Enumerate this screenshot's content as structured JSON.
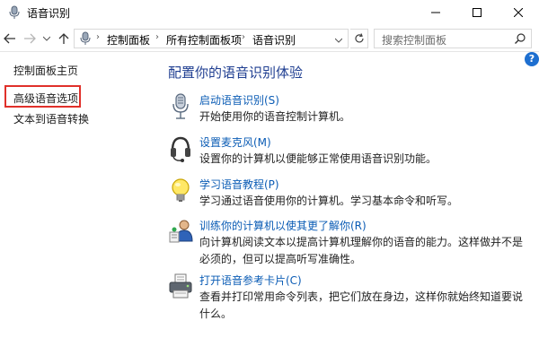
{
  "window": {
    "title": "语音识别"
  },
  "address_bar": {
    "breadcrumbs": [
      "控制面板",
      "所有控制面板项",
      "语音识别"
    ]
  },
  "search": {
    "placeholder": "搜索控制面板"
  },
  "help": {
    "label": "?"
  },
  "sidebar": {
    "items": [
      {
        "label": "控制面板主页"
      },
      {
        "label": "高级语音选项"
      },
      {
        "label": "文本到语音转换"
      }
    ]
  },
  "main": {
    "title": "配置你的语音识别体验",
    "tasks": [
      {
        "icon": "microphone-icon",
        "link": "启动语音识别(S)",
        "description": "开始使用你的语音控制计算机。"
      },
      {
        "icon": "headset-icon",
        "link": "设置麦克风(M)",
        "description": "设置你的计算机以便能够正常使用语音识别功能。"
      },
      {
        "icon": "lightbulb-icon",
        "link": "学习语音教程(P)",
        "description": "学习通过语音使用你的计算机。学习基本命令和听写。"
      },
      {
        "icon": "user-training-icon",
        "link": "训练你的计算机以使其更了解你(R)",
        "description": "向计算机阅读文本以提高计算机理解你的语音的能力。这样做并不是必须的，但可以提高听写准确性。"
      },
      {
        "icon": "printer-icon",
        "link": "打开语音参考卡片(C)",
        "description": "查看并打印常用命令列表，把它们放在身边，这样你就始终知道要说什么。"
      }
    ]
  },
  "colors": {
    "link": "#0b5cb5",
    "title": "#1f3e91",
    "highlight": "#e0302a"
  }
}
